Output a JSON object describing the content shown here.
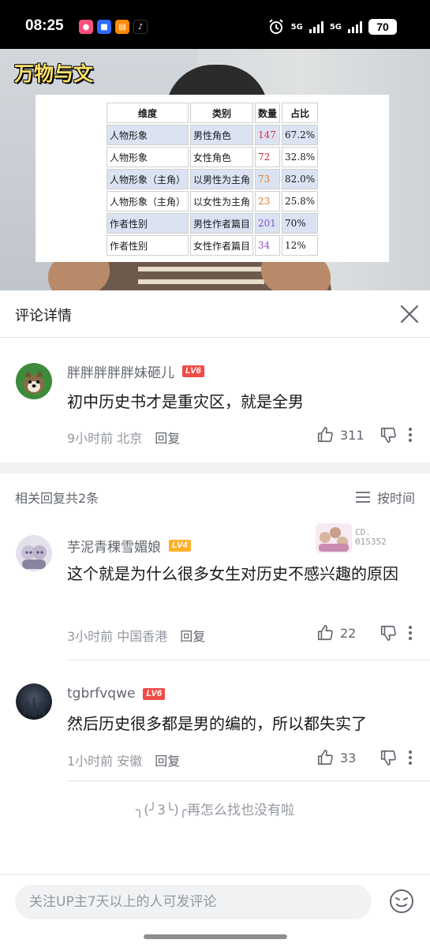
{
  "status_bar": {
    "time": "08:25",
    "network_1": "5G",
    "network_2": "5G",
    "battery": "70"
  },
  "video": {
    "logo_text": "万物与文",
    "table": {
      "headers": [
        "维度",
        "类别",
        "数量",
        "占比"
      ],
      "rows": [
        {
          "dim": "人物形象",
          "cat": "男性角色",
          "count": "147",
          "pct": "67.2%",
          "count_color": "#d6303a"
        },
        {
          "dim": "人物形象",
          "cat": "女性角色",
          "count": "72",
          "pct": "32.8%",
          "count_color": "#d6303a"
        },
        {
          "dim": "人物形象（主角）",
          "cat": "以男性为主角",
          "count": "73",
          "pct": "82.0%",
          "count_color": "#e07a2a"
        },
        {
          "dim": "人物形象（主角）",
          "cat": "以女性为主角",
          "count": "23",
          "pct": "25.8%",
          "count_color": "#e07a2a"
        },
        {
          "dim": "作者性别",
          "cat": "男性作者篇目",
          "count": "201",
          "pct": "70%",
          "count_color": "#8a4fc4"
        },
        {
          "dim": "作者性别",
          "cat": "女性作者篇目",
          "count": "34",
          "pct": "12%",
          "count_color": "#8a4fc4"
        }
      ]
    }
  },
  "panel": {
    "title": "评论详情"
  },
  "main_comment": {
    "username": "胖胖胖胖胖妹砸儿",
    "level": "LV6",
    "text": "初中历史书才是重灾区，就是全男",
    "time": "9小时前",
    "location": "北京",
    "reply_label": "回复",
    "likes": "311"
  },
  "replies_header": {
    "count_text": "相关回复共2条",
    "sort_label": "按时间"
  },
  "replies": [
    {
      "username": "芋泥青稞雪媚娘",
      "level": "LV4",
      "badge_no_1": "CD.",
      "badge_no_2": "015352",
      "text": "这个就是为什么很多女生对历史不感兴趣的原因",
      "time": "3小时前",
      "location": "中国香港",
      "reply_label": "回复",
      "likes": "22"
    },
    {
      "username": "tgbrfvqwe",
      "level": "LV6",
      "text": "然后历史很多都是男的编的，所以都失实了",
      "time": "1小时前",
      "location": "安徽",
      "reply_label": "回复",
      "likes": "33"
    }
  ],
  "end_text": "╮(╯3╰)╭再怎么找也没有啦",
  "input": {
    "placeholder": "关注UP主7天以上的人可发评论"
  }
}
